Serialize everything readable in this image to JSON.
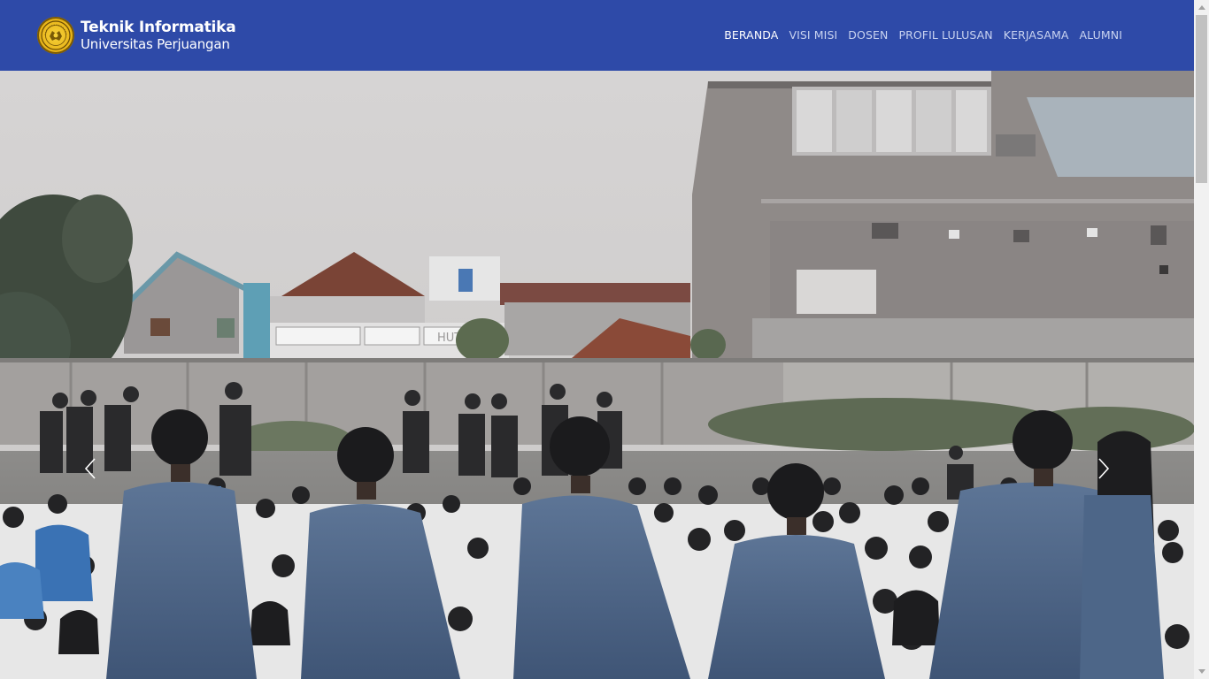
{
  "header": {
    "brand_title": "Teknik Informatika",
    "brand_subtitle": "Universitas Perjuangan",
    "logo_icon": "university-seal-icon",
    "background_color": "#2e4aa8"
  },
  "nav": {
    "items": [
      {
        "label": "BERANDA",
        "active": true
      },
      {
        "label": "VISI MISI",
        "active": false
      },
      {
        "label": "DOSEN",
        "active": false
      },
      {
        "label": "PROFIL LULUSAN",
        "active": false
      },
      {
        "label": "KERJASAMA",
        "active": false
      },
      {
        "label": "ALUMNI",
        "active": false
      }
    ]
  },
  "hero": {
    "image_subject": "students-gathering-photo",
    "building_sign_text": "HUT",
    "prev_icon": "chevron-left-icon",
    "next_icon": "chevron-right-icon"
  }
}
